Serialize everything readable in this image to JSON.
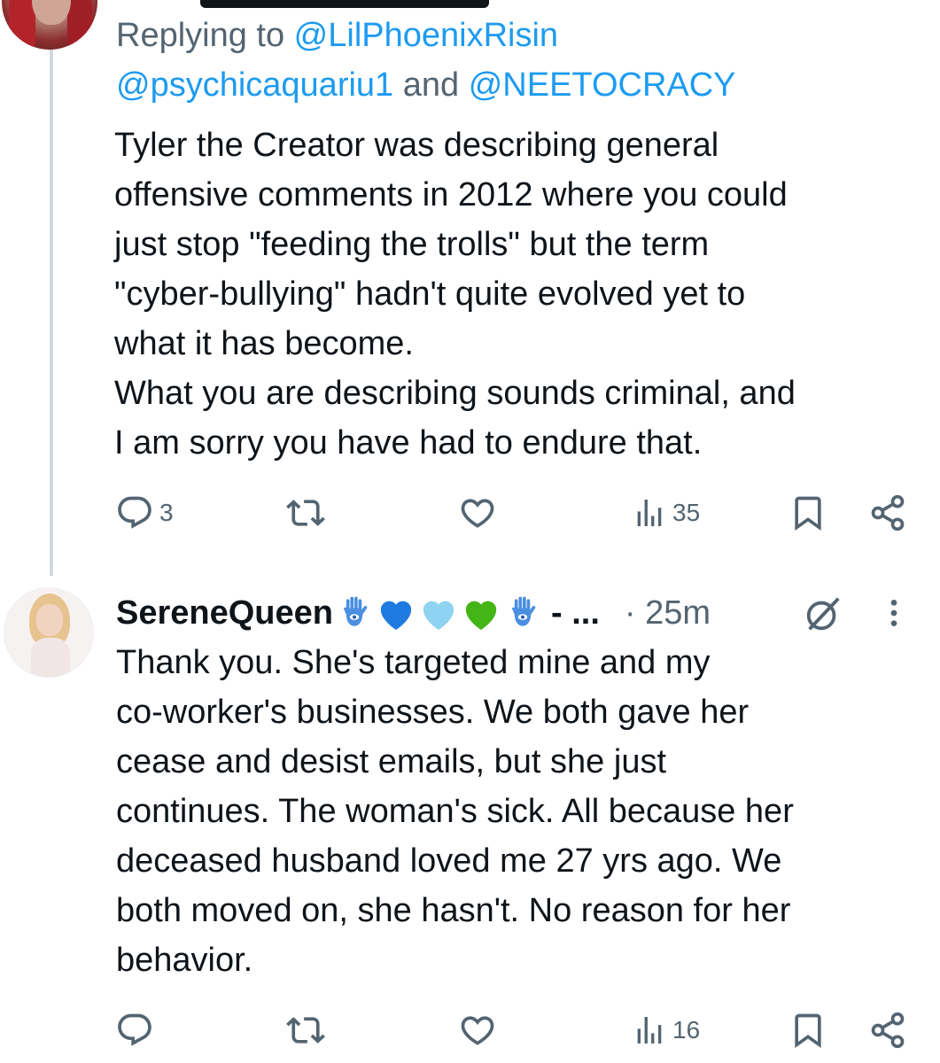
{
  "reply_context": {
    "prefix": "Replying to ",
    "mention1": "@LilPhoenixRisin",
    "mention2": "@psychicaquariu1",
    "joiner": " and ",
    "mention3": "@NEETOCRACY"
  },
  "tweet1": {
    "text": "Tyler the Creator was describing general\noffensive comments in 2012 where you could\njust stop \"feeding the trolls\" but the term\n\"cyber-bullying\" hadn't quite evolved yet to\nwhat it has become.\nWhat you are describing sounds criminal, and\nI am sorry you have had to endure that.",
    "actions": {
      "replies": "3",
      "retweets": "",
      "likes": "",
      "views": "35"
    }
  },
  "tweet2": {
    "display_name": "SereneQueen",
    "name_suffix": "- ...",
    "time": "· 25m",
    "emojis": [
      "hamsa-icon",
      "blue-heart-icon",
      "light-blue-heart-icon",
      "green-heart-icon",
      "hamsa-icon"
    ],
    "text": "Thank you.  She's targeted mine and my\nco-worker's businesses. We both gave her\ncease and desist emails, but she just\ncontinues. The woman's sick. All because her\ndeceased husband loved me 27 yrs ago. We\nboth moved on, she hasn't.  No reason for her\nbehavior.",
    "actions": {
      "replies": "",
      "retweets": "",
      "likes": "",
      "views": "16"
    }
  },
  "colors": {
    "text": "#0f1419",
    "secondary": "#536471",
    "link": "#1d9bf0",
    "thread_line": "#cfd9de"
  }
}
